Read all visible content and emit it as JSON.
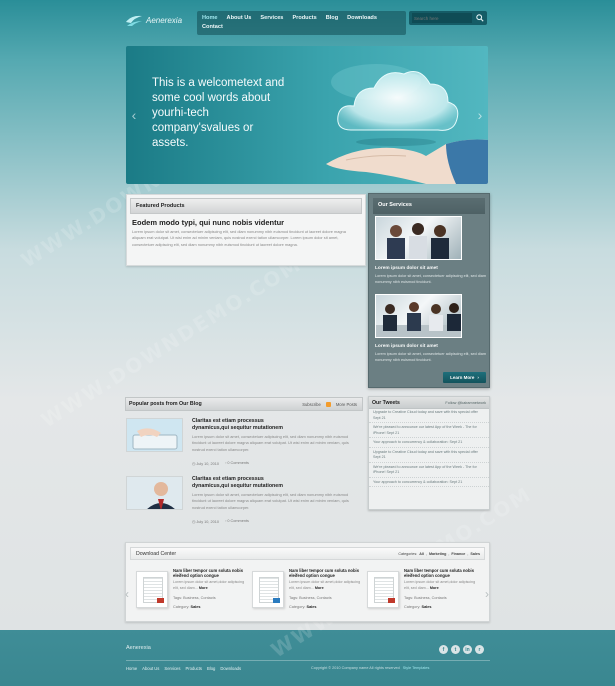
{
  "header": {
    "logo_text": "Aenerexia",
    "nav": [
      "Home",
      "About Us",
      "Services",
      "Products",
      "Blog",
      "Downloads",
      "Contact"
    ],
    "active_nav": "Home",
    "search_placeholder": "Search here"
  },
  "hero": {
    "text": "This is a welcometext and some cool words about yourhi-tech company'svalues or assets."
  },
  "featured": {
    "heading": "Featured Products",
    "title": "Eodem modo typi, qui nunc nobis videntur",
    "body": "Lorem ipsum dolor sit amet, consectetuer adipiscing elit, sed diam nonummy nibh euismod tincidunt ut laoreet dolore magna aliquam erat volutpat. Ut wisi enim ad minim veniam, quis nostrud exerci tation ullamcorper. Lorem ipsum dolor sit amet, consectetuer adipiscing elit, sed diam nonummy nibh euismod tincidunt ut laoreet dolore magna."
  },
  "services": {
    "heading": "Our Services",
    "items": [
      {
        "title": "Lorem ipsum dolor sit amet",
        "text": "Lorem ipsum dolor sit amet, consectetuer adipiscing elit, sed diam nonummy nibh euismod tincidunt."
      },
      {
        "title": "Lorem ipsum dolor sit amet",
        "text": "Lorem ipsum dolor sit amet, consectetuer adipiscing elit, sed diam nonummy nibh euismod tincidunt."
      }
    ],
    "button": "Learn More"
  },
  "blog": {
    "heading": "Popular posts from Our Blog",
    "subscribe": "Subscribe",
    "more_posts": "More Posts",
    "posts": [
      {
        "title": "Claritas est etiam processus dynamicus,qui sequitur mutationem",
        "text": "Lorem ipsum dolor sit amet, consectetuer adipiscing elit, sed diam nonummy nibh euismod tincidunt ut laoreet dolore magna aliquam erat volutpat. Ut wisi enim ad minim veniam, quis nostrud exerci tation ullamcorper.",
        "date": "July 10, 2010",
        "comments": "0 Comments"
      },
      {
        "title": "Claritas est etiam processus dynamicus,qui sequitur mutationem",
        "text": "Lorem ipsum dolor sit amet, consectetuer adipiscing elit, sed diam nonummy nibh euismod tincidunt ut laoreet dolore magna aliquam erat volutpat. Ut wisi enim ad minim veniam, quis nostrud exerci tation ullamcorper.",
        "date": "July 10, 2010",
        "comments": "0 Comments"
      }
    ]
  },
  "tweets": {
    "heading": "Our Tweets",
    "follow": "Follow @kairamnetwork",
    "items": [
      "Upgrade to Creative Cloud today and save with this special offer Sept 21",
      "We're pleased to announce our latest App of the Week - The for iPhone! Sept 21",
      "Your approach to concurrency & collaboration: Sept 21",
      "Upgrade to Creative Cloud today and save with this special offer Sept 21",
      "We're pleased to announce our latest App of the Week - The for iPhone! Sept 21",
      "Your approach to concurrency & collaboration: Sept 21"
    ]
  },
  "downloads": {
    "heading": "Download Center",
    "categories_label": "Categories:",
    "categories": [
      "All",
      "Marketing",
      "Finance",
      "Sales"
    ],
    "items": [
      {
        "title": "Nam liber tempor cum soluta nobis eleifend option congue",
        "desc": "Lorem ipsum dolor sit amet,dolor adipiscing elit, sed diam...",
        "more": "More",
        "tags": "Tags: Business, Contacts",
        "category_label": "Category:",
        "category": "Sales"
      },
      {
        "title": "Nam liber tempor cum soluta nobis eleifend option congue",
        "desc": "Lorem ipsum dolor sit amet,dolor adipiscing elit, sed diam...",
        "more": "More",
        "tags": "Tags: Business, Contacts",
        "category_label": "Category:",
        "category": "Sales"
      },
      {
        "title": "Nam liber tempor cum soluta nobis eleifend option congue",
        "desc": "Lorem ipsum dolor sit amet,dolor adipiscing elit, sed diam...",
        "more": "More",
        "tags": "Tags: Business, Contacts",
        "category_label": "Category:",
        "category": "Sales"
      }
    ]
  },
  "footer": {
    "brand": "Aenerexia",
    "nav": [
      "Home",
      "About Us",
      "Services",
      "Products",
      "Blog",
      "Downloads"
    ],
    "copyright": "Copyright © 2010 Company name All rights reserved",
    "credit": "Style Templates"
  },
  "watermark": "WWW.DOWNDEMO.COM"
}
